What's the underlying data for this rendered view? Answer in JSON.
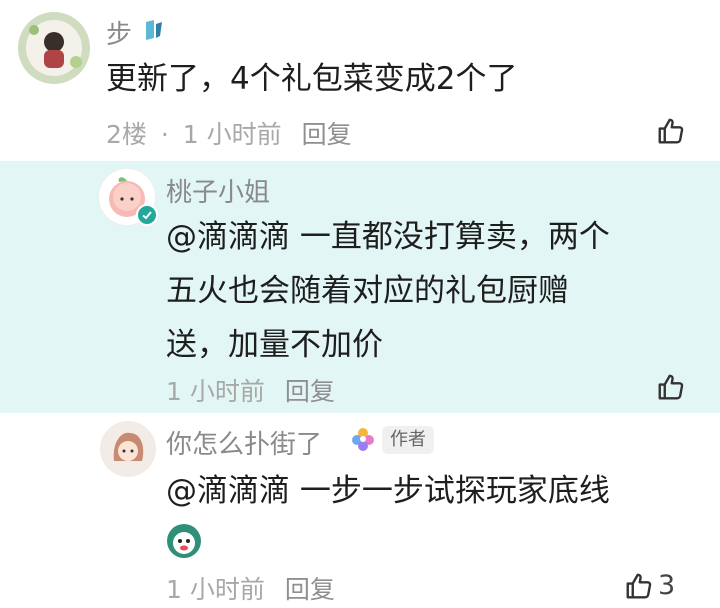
{
  "comments": [
    {
      "user": "步",
      "text": "更新了，4个礼包菜变成2个了",
      "floor": "2楼",
      "separator": "·",
      "time": "1 小时前",
      "reply_label": "回复"
    },
    {
      "user": "桃子小姐",
      "text_line1": "@滴滴滴  一直都没打算卖，两个",
      "text_line2": "五火也会随着对应的礼包厨赠",
      "text_line3": "送，加量不加价",
      "time": "1 小时前",
      "reply_label": "回复"
    },
    {
      "user": "你怎么扑街了",
      "author_badge": "作者",
      "text": "@滴滴滴  一步一步试探玩家底线",
      "time": "1 小时前",
      "reply_label": "回复",
      "like_count": "3"
    }
  ],
  "colors": {
    "highlight_bg": "#e2f7f5",
    "verified": "#23a99b",
    "meta_text": "#a8a8a8"
  }
}
